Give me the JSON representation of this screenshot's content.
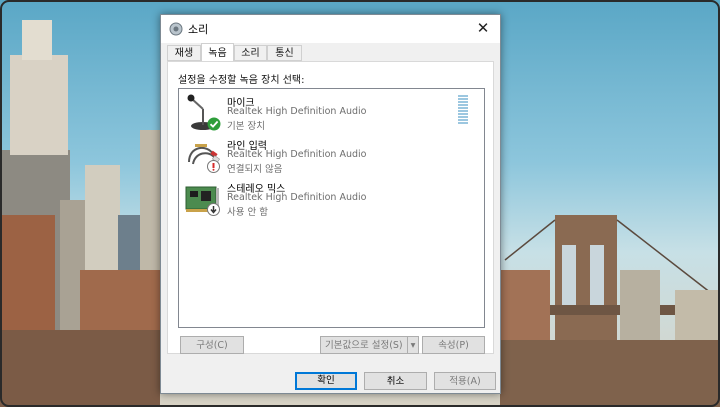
{
  "window": {
    "title": "소리",
    "close_glyph": "✕"
  },
  "tabs": [
    {
      "label": "재생",
      "active": false
    },
    {
      "label": "녹음",
      "active": true
    },
    {
      "label": "소리",
      "active": false
    },
    {
      "label": "통신",
      "active": false
    }
  ],
  "panel": {
    "instruction": "설정을 수정할 녹음 장치 선택:"
  },
  "devices": [
    {
      "name": "마이크",
      "driver": "Realtek High Definition Audio",
      "status": "기본 장치",
      "status_icon": "default-check-icon",
      "device_icon": "microphone-icon"
    },
    {
      "name": "라인 입력",
      "driver": "Realtek High Definition Audio",
      "status": "연결되지 않음",
      "status_icon": "disconnected-icon",
      "device_icon": "line-in-cable-icon"
    },
    {
      "name": "스테레오 믹스",
      "driver": "Realtek High Definition Audio",
      "status": "사용 안 함",
      "status_icon": "disabled-arrow-icon",
      "device_icon": "sound-card-icon"
    }
  ],
  "panel_buttons": {
    "configure": "구성(C)",
    "set_default": "기본값으로 설정(S)",
    "set_default_arrow": "▾",
    "properties": "속성(P)"
  },
  "dialog_buttons": {
    "ok": "확인",
    "cancel": "취소",
    "apply": "적용(A)"
  },
  "colors": {
    "accent": "#0078d7",
    "check_green": "#2e9e3a",
    "disconnected_red": "#d62b2b"
  }
}
